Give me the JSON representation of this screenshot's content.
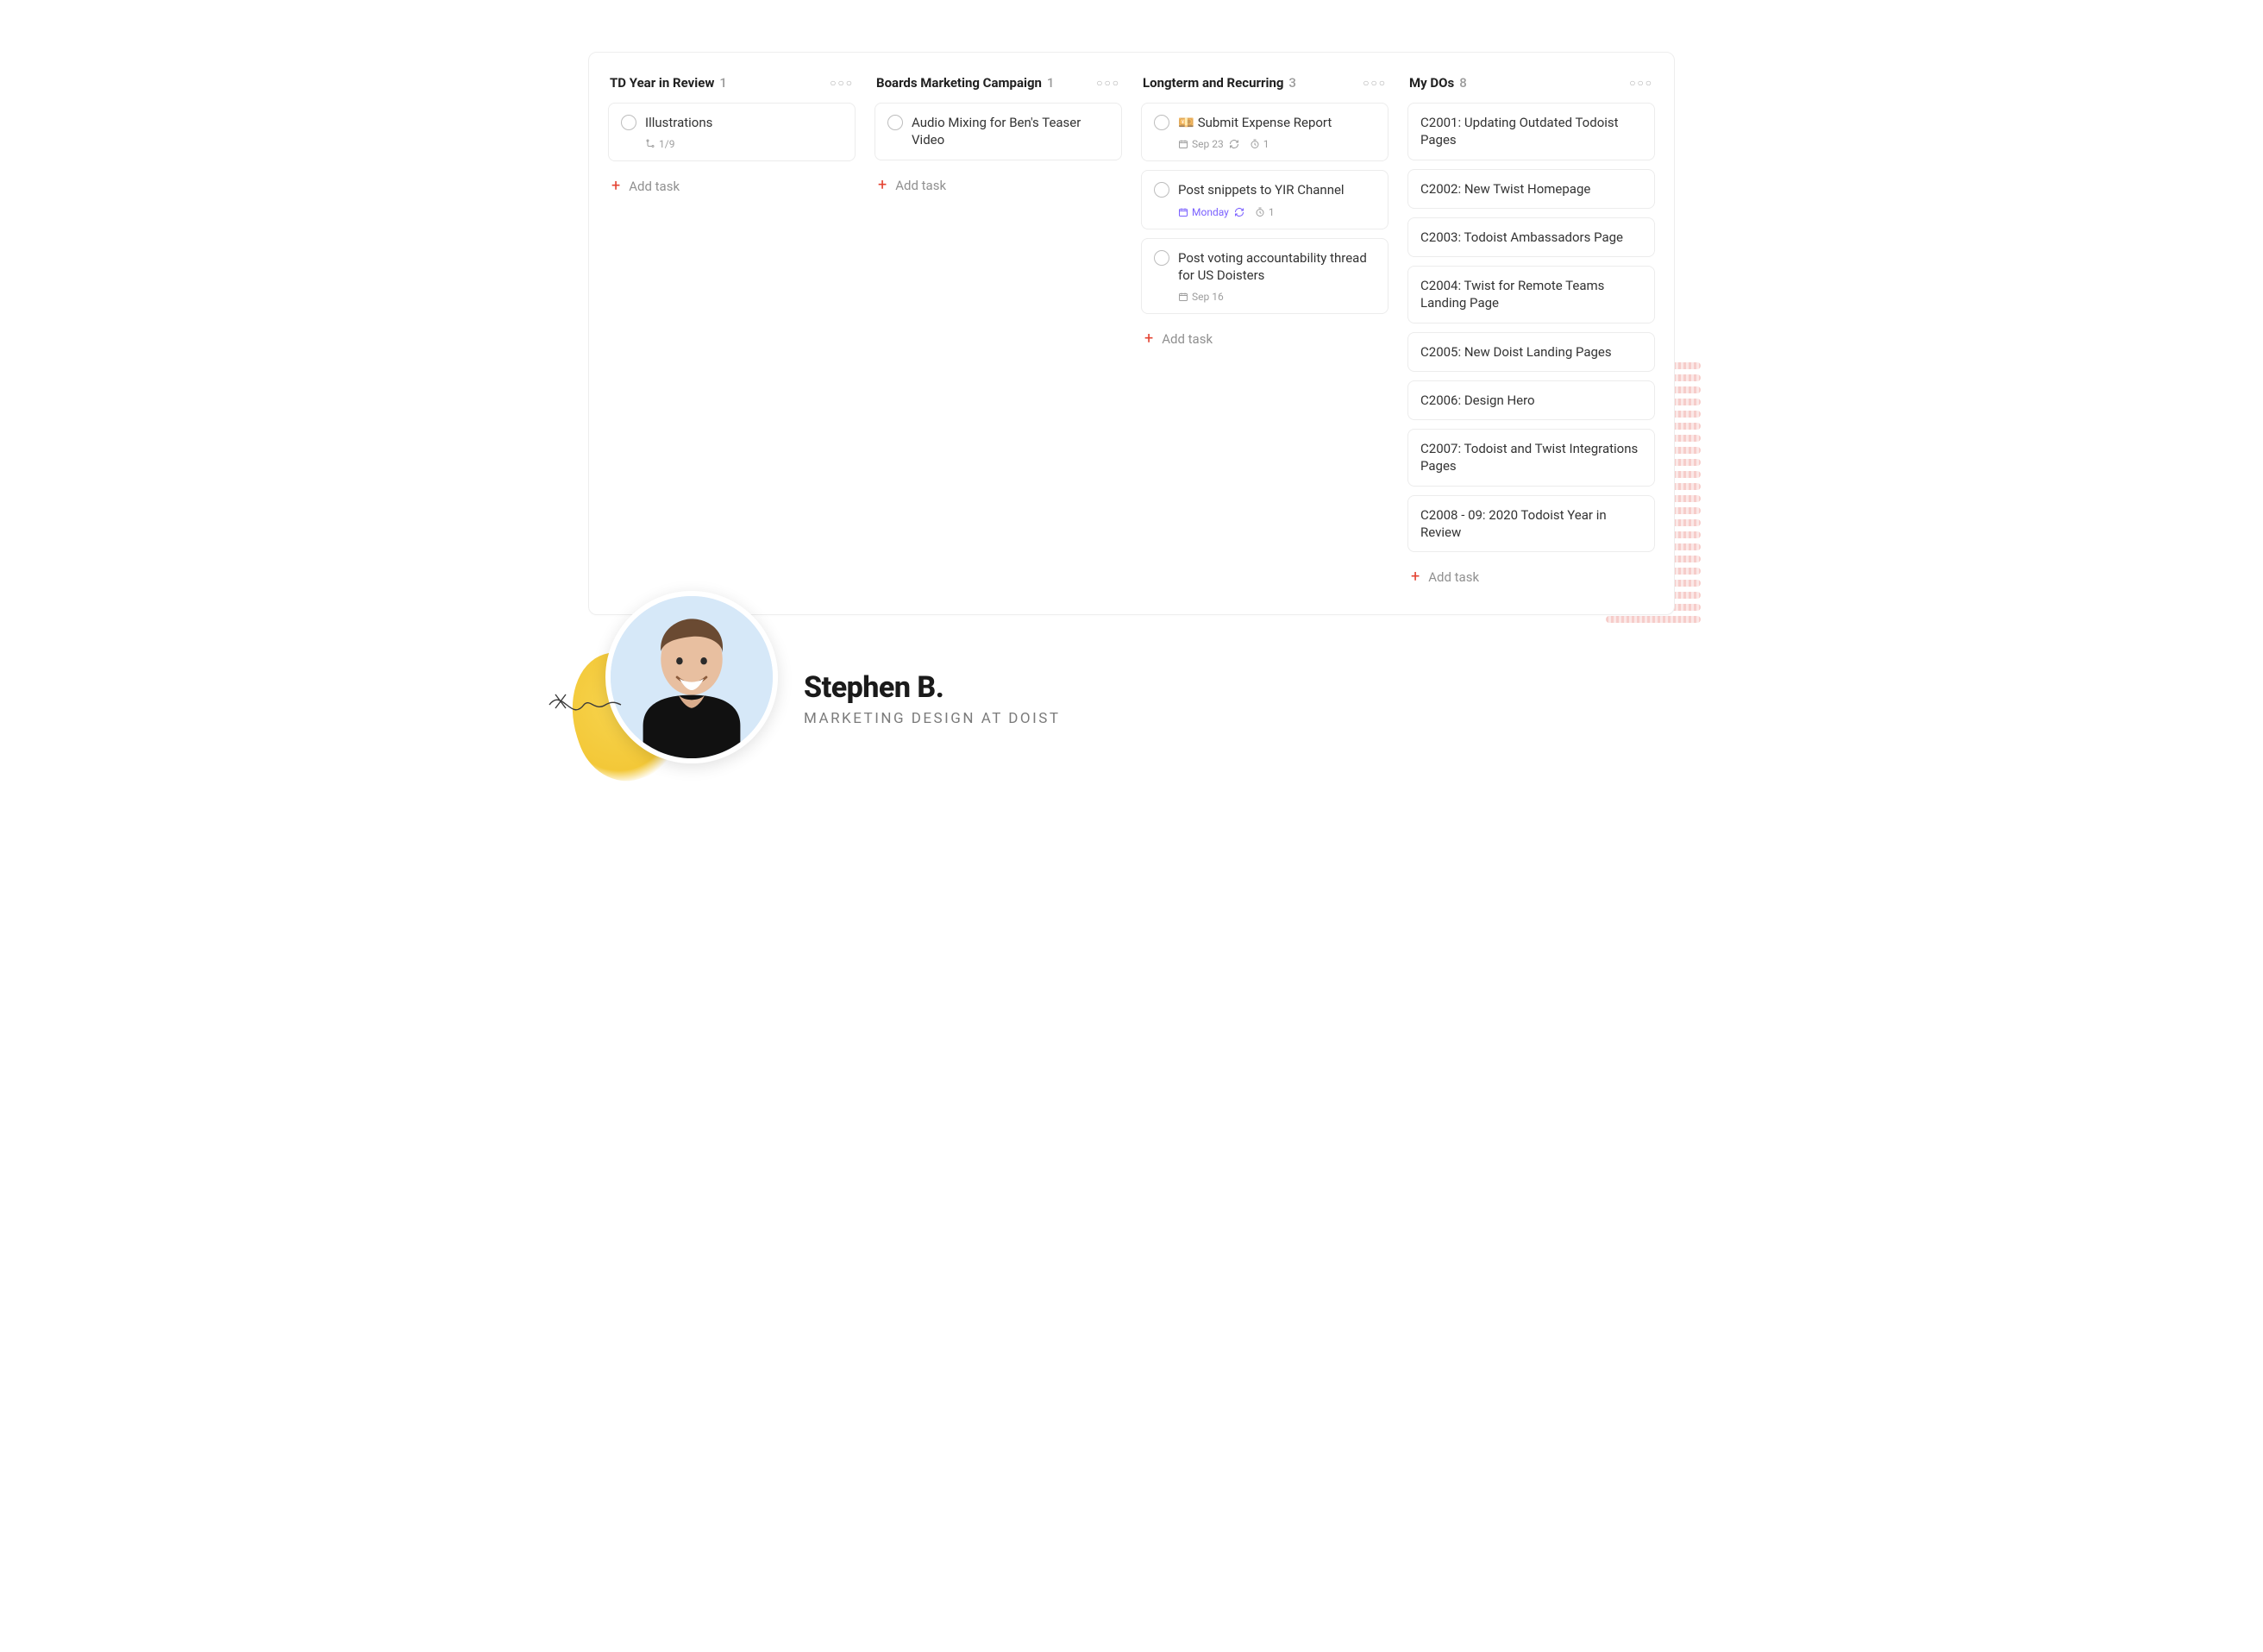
{
  "add_task_label": "Add task",
  "author": {
    "name": "Stephen B.",
    "role": "Marketing Design at Doist"
  },
  "columns": [
    {
      "title": "TD Year in Review",
      "count": "1",
      "cards": [
        {
          "title": "Illustrations",
          "has_checkbox": true,
          "meta": {
            "subtask": "1/9"
          }
        }
      ]
    },
    {
      "title": "Boards Marketing Campaign",
      "count": "1",
      "cards": [
        {
          "title": "Audio Mixing for Ben's Teaser Video",
          "has_checkbox": true,
          "meta": null
        }
      ]
    },
    {
      "title": "Longterm and Recurring",
      "count": "3",
      "cards": [
        {
          "title": "Submit Expense Report",
          "emoji": "💴",
          "has_checkbox": true,
          "meta": {
            "date": "Sep 23",
            "recurring": true,
            "reminders": "1",
            "date_color": "default"
          }
        },
        {
          "title": "Post snippets to YIR Channel",
          "has_checkbox": true,
          "meta": {
            "date": "Monday",
            "recurring": true,
            "reminders": "1",
            "date_color": "purple"
          }
        },
        {
          "title": "Post voting accountability thread for US Doisters",
          "has_checkbox": true,
          "meta": {
            "date": "Sep 16",
            "date_color": "default"
          }
        }
      ]
    },
    {
      "title": "My DOs",
      "count": "8",
      "cards": [
        {
          "title": "C2001: Updating Outdated Todoist Pages",
          "has_checkbox": false
        },
        {
          "title": "C2002: New Twist Homepage",
          "has_checkbox": false
        },
        {
          "title": "C2003: Todoist Ambassadors Page",
          "has_checkbox": false
        },
        {
          "title": "C2004: Twist for Remote Teams Landing Page",
          "has_checkbox": false
        },
        {
          "title": "C2005: New Doist Landing Pages",
          "has_checkbox": false
        },
        {
          "title": "C2006: Design Hero",
          "has_checkbox": false
        },
        {
          "title": "C2007: Todoist and Twist Integrations Pages",
          "has_checkbox": false
        },
        {
          "title": "C2008 - 09: 2020 Todoist Year in Review",
          "has_checkbox": false
        }
      ]
    }
  ]
}
